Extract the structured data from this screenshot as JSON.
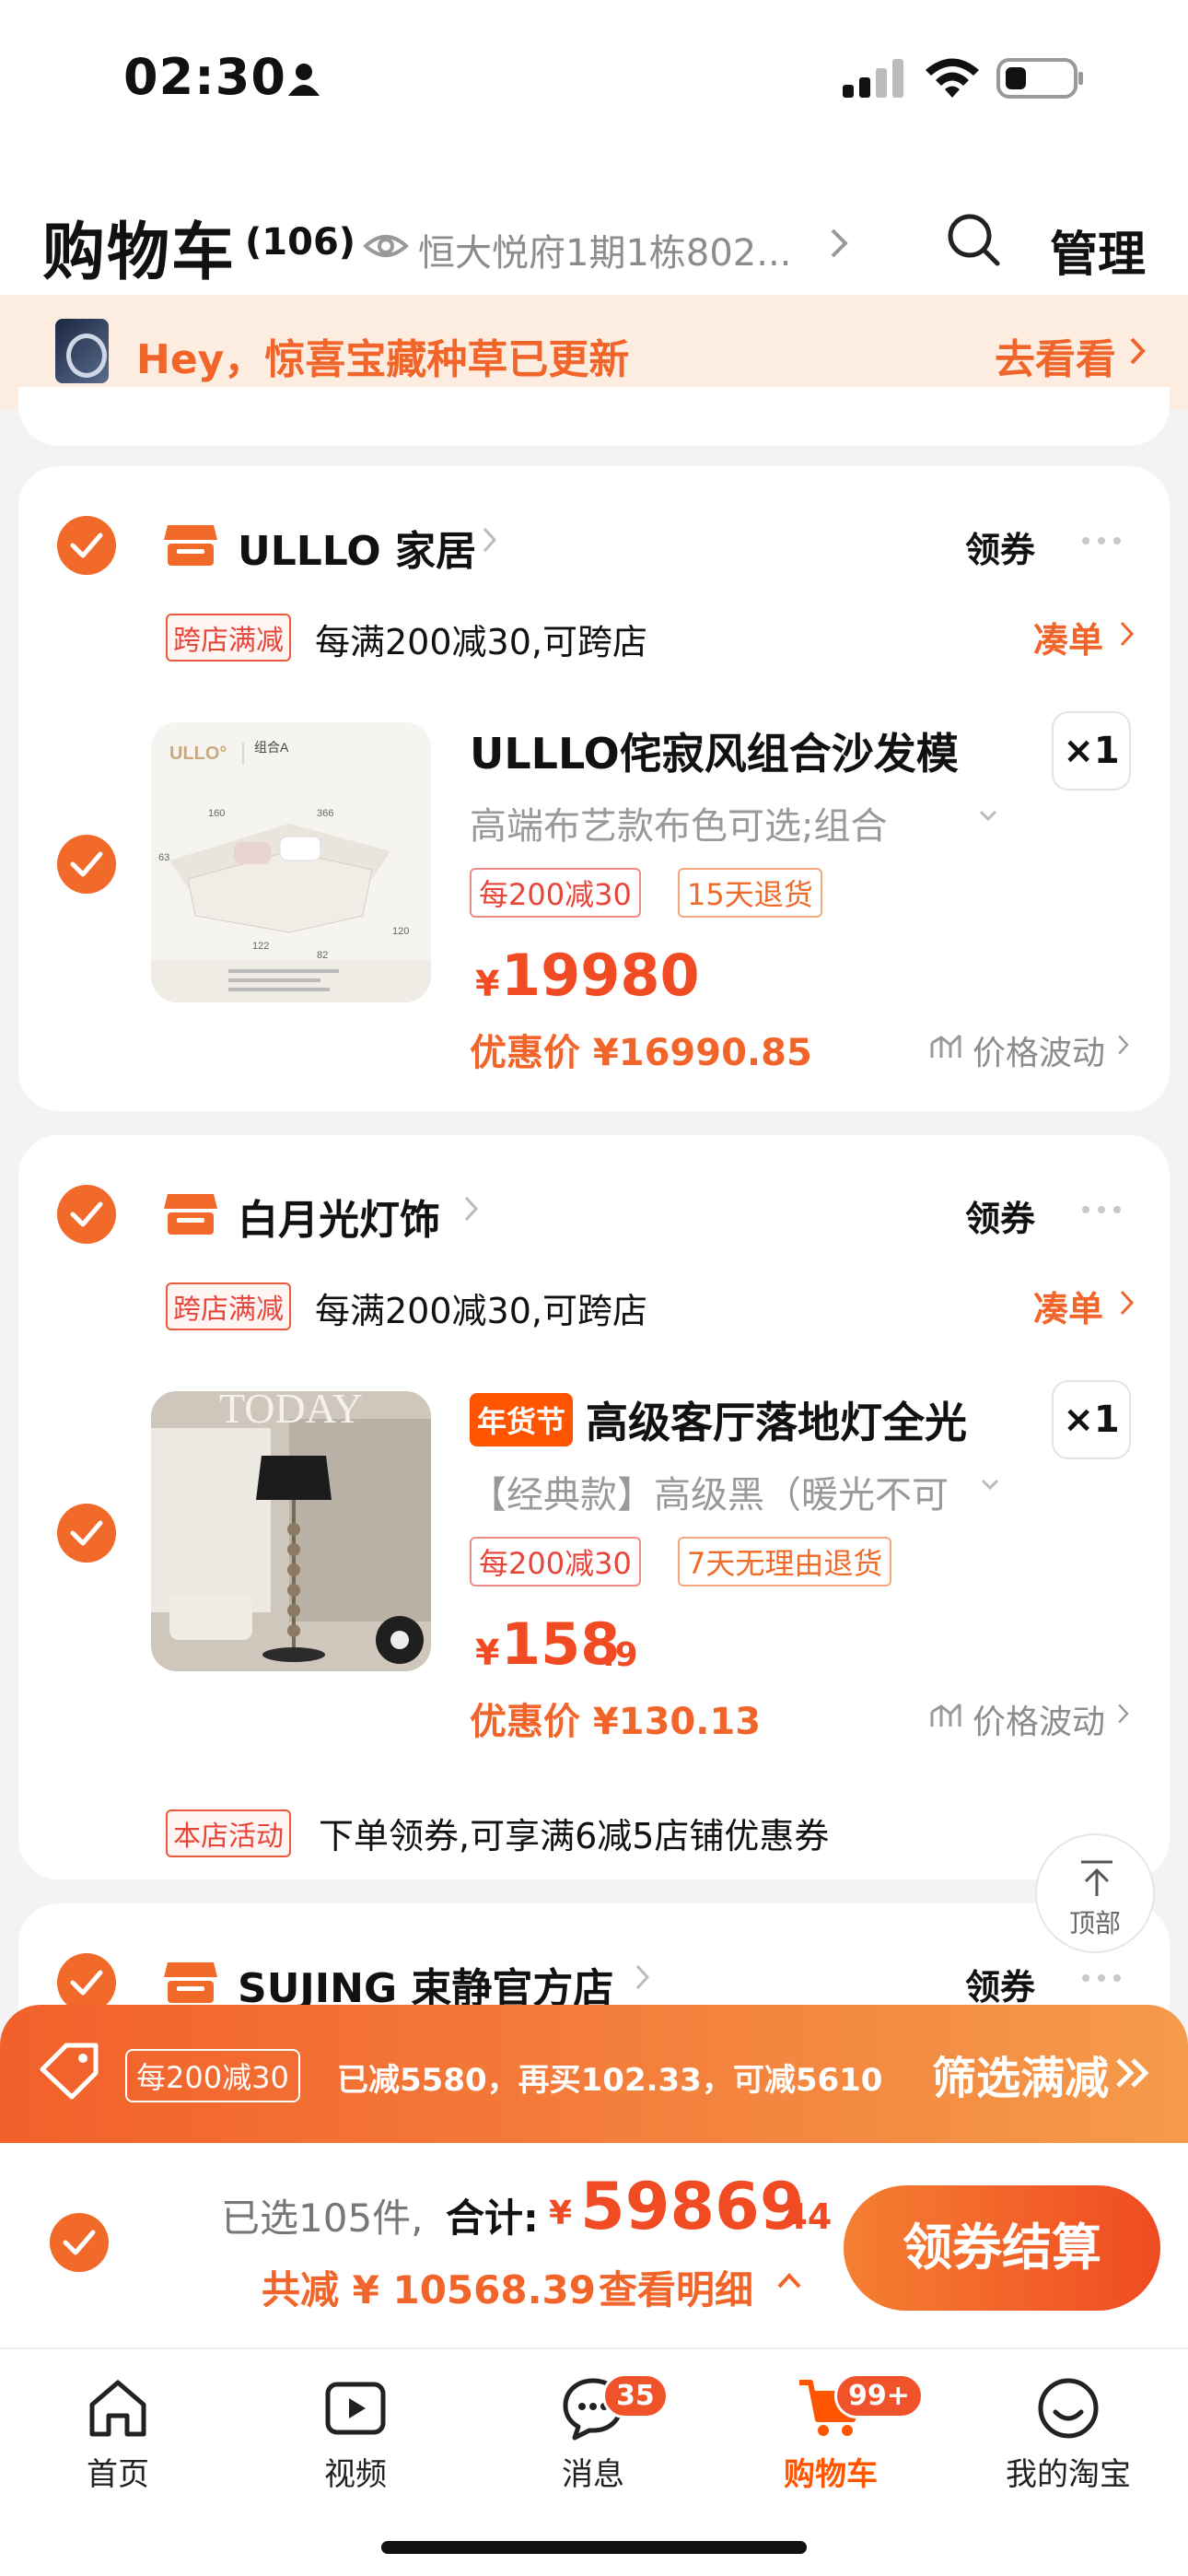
{
  "status_bar": {
    "time": "02:30"
  },
  "header": {
    "title": "购物车",
    "count": "(106)",
    "address": "恒大悦府1期1栋802...",
    "manage_label": "管理"
  },
  "banner": {
    "text": "Hey，惊喜宝藏种草已更新",
    "action": "去看看"
  },
  "stores": [
    {
      "name": "ULLLO 家居",
      "coupon_label": "领券",
      "promo_tag": "跨店满减",
      "promo_text": "每满200减30,可跨店",
      "collect_label": "凑单",
      "product": {
        "title": "ULLLO侘寂风组合沙发模",
        "spec": "高端布艺款布色可选;组合",
        "tags": [
          "每200减30",
          "15天退货"
        ],
        "price_symbol": "¥",
        "price_int": "19980",
        "price_dec": "",
        "promo_price": "优惠价 ¥16990.85",
        "price_wave": "价格波动",
        "qty": "×1",
        "thumb_brand": "ULLO°",
        "thumb_label": "组合A",
        "thumb_dims": [
          "160",
          "366",
          "63",
          "122",
          "82",
          "120"
        ]
      }
    },
    {
      "name": "白月光灯饰",
      "coupon_label": "领券",
      "promo_tag": "跨店满减",
      "promo_text": "每满200减30,可跨店",
      "collect_label": "凑单",
      "product": {
        "badge": "年货节",
        "title": "高级客厅落地灯全光",
        "spec": "【经典款】高级黑（暖光不可",
        "tags": [
          "每200减30",
          "7天无理由退货"
        ],
        "price_symbol": "¥",
        "price_int": "158",
        "price_dec": ".9",
        "promo_price": "优惠价 ¥130.13",
        "price_wave": "价格波动",
        "qty": "×1",
        "thumb_text": "TODAY"
      },
      "activity_tag": "本店活动",
      "activity_text": "下单领券,可享满6减5店铺优惠券"
    },
    {
      "name": "SUJING 束静官方店",
      "coupon_label": "领券"
    }
  ],
  "back_to_top": "顶部",
  "promo_bar": {
    "tag": "每200减30",
    "text": "已减5580，再买102.33，可减5610",
    "filter": "筛选满减"
  },
  "summary": {
    "selected": "已选105件,",
    "total_label": "合计:",
    "total_symbol": "¥",
    "total_int": "59869",
    "total_dec": ".44",
    "saved": "共减 ¥ 10568.39",
    "detail": "查看明细",
    "checkout": "领券结算"
  },
  "tabs": [
    {
      "label": "首页",
      "icon": "home-icon"
    },
    {
      "label": "视频",
      "icon": "video-icon"
    },
    {
      "label": "消息",
      "icon": "message-icon",
      "badge": "35"
    },
    {
      "label": "购物车",
      "icon": "cart-icon",
      "badge": "99+",
      "active": true
    },
    {
      "label": "我的淘宝",
      "icon": "profile-icon"
    }
  ],
  "colors": {
    "accent": "#f2652a",
    "price": "#f04b22",
    "brand": "#ff5500"
  }
}
